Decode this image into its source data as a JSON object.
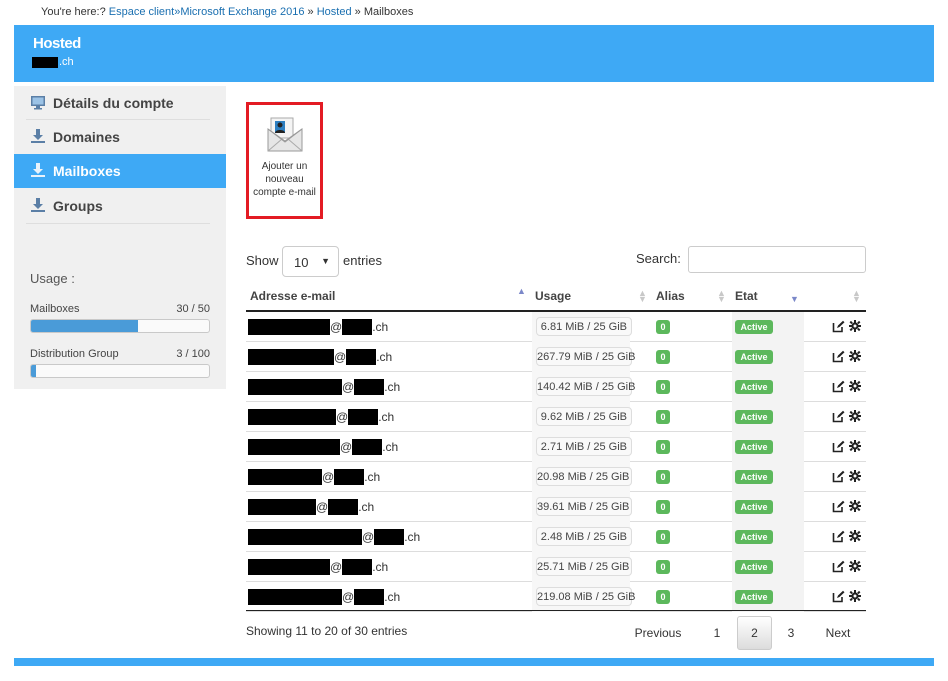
{
  "breadcrumb": {
    "prefix": "You're here:?",
    "items": [
      "Espace client",
      "»Microsoft Exchange 2016",
      "Hosted"
    ],
    "current": "Mailboxes",
    "sep": "»"
  },
  "header": {
    "title": "Hosted",
    "domain_suffix": ".ch"
  },
  "sidebar": {
    "items": [
      {
        "label": "Détails du compte",
        "icon": "monitor-icon",
        "active": false
      },
      {
        "label": "Domaines",
        "icon": "download-icon",
        "active": false
      },
      {
        "label": "Mailboxes",
        "icon": "download-icon",
        "active": true
      },
      {
        "label": "Groups",
        "icon": "download-icon",
        "active": false
      }
    ],
    "usage_title": "Usage :",
    "usage": [
      {
        "label": "Mailboxes",
        "count": "30 / 50",
        "fraction": 0.6
      },
      {
        "label": "Distribution Group",
        "count": "3 / 100",
        "fraction": 0.03
      }
    ]
  },
  "add_button": {
    "label": "Ajouter un nouveau compte e-mail",
    "icon": "add-mail-icon"
  },
  "table_controls": {
    "show_label": "Show",
    "length": "10",
    "entries_label": "entries",
    "search_label": "Search:",
    "search_value": ""
  },
  "columns": [
    "Adresse e-mail",
    "Usage",
    "Alias",
    "Etat"
  ],
  "rows": [
    {
      "domain_suffix": ".ch",
      "usage": "6.81 MiB / 25 GiB",
      "alias": "0",
      "status": "Active"
    },
    {
      "domain_suffix": ".ch",
      "usage": "267.79 MiB / 25 GiB",
      "alias": "0",
      "status": "Active"
    },
    {
      "domain_suffix": ".ch",
      "usage": "140.42 MiB / 25 GiB",
      "alias": "0",
      "status": "Active"
    },
    {
      "domain_suffix": ".ch",
      "usage": "9.62 MiB / 25 GiB",
      "alias": "0",
      "status": "Active"
    },
    {
      "domain_suffix": ".ch",
      "usage": "2.71 MiB / 25 GiB",
      "alias": "0",
      "status": "Active"
    },
    {
      "domain_suffix": ".ch",
      "usage": "20.98 MiB / 25 GiB",
      "alias": "0",
      "status": "Active"
    },
    {
      "domain_suffix": ".ch",
      "usage": "39.61 MiB / 25 GiB",
      "alias": "0",
      "status": "Active"
    },
    {
      "domain_suffix": ".ch",
      "usage": "2.48 MiB / 25 GiB",
      "alias": "0",
      "status": "Active"
    },
    {
      "domain_suffix": ".ch",
      "usage": "25.71 MiB / 25 GiB",
      "alias": "0",
      "status": "Active"
    },
    {
      "domain_suffix": ".ch",
      "usage": "219.08 MiB / 25 GiB",
      "alias": "0",
      "status": "Active"
    }
  ],
  "at_sign": "@",
  "footer_info": "Showing 11 to 20 of 30 entries",
  "pagination": {
    "previous": "Previous",
    "pages": [
      "1",
      "2",
      "3"
    ],
    "current": "2",
    "next": "Next"
  },
  "colors": {
    "accent": "#3ea9f5",
    "badge_green": "#5cb85c",
    "highlight_red": "#e31b23"
  }
}
